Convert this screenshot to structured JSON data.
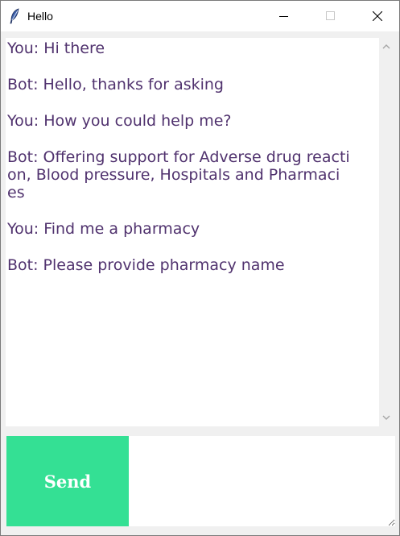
{
  "window": {
    "title": "Hello",
    "icon": "feather-icon",
    "controls": [
      "minimize-icon",
      "maximize-icon",
      "close-icon"
    ]
  },
  "chat": {
    "messages": [
      {
        "lines": [
          "You: Hi there"
        ]
      },
      {
        "lines": [
          "Bot: Hello, thanks for asking"
        ]
      },
      {
        "lines": [
          "You: How you could help me?"
        ]
      },
      {
        "lines": [
          "Bot: Offering support for Adverse drug reacti",
          "on, Blood pressure, Hospitals and Pharmaci",
          "es"
        ]
      },
      {
        "lines": [
          "You: Find me a pharmacy"
        ]
      },
      {
        "lines": [
          "Bot: Please provide pharmacy name"
        ]
      }
    ],
    "text_color": "#50326e"
  },
  "composer": {
    "send_label": "Send",
    "send_color": "#34e094",
    "input_value": "",
    "input_placeholder": ""
  }
}
